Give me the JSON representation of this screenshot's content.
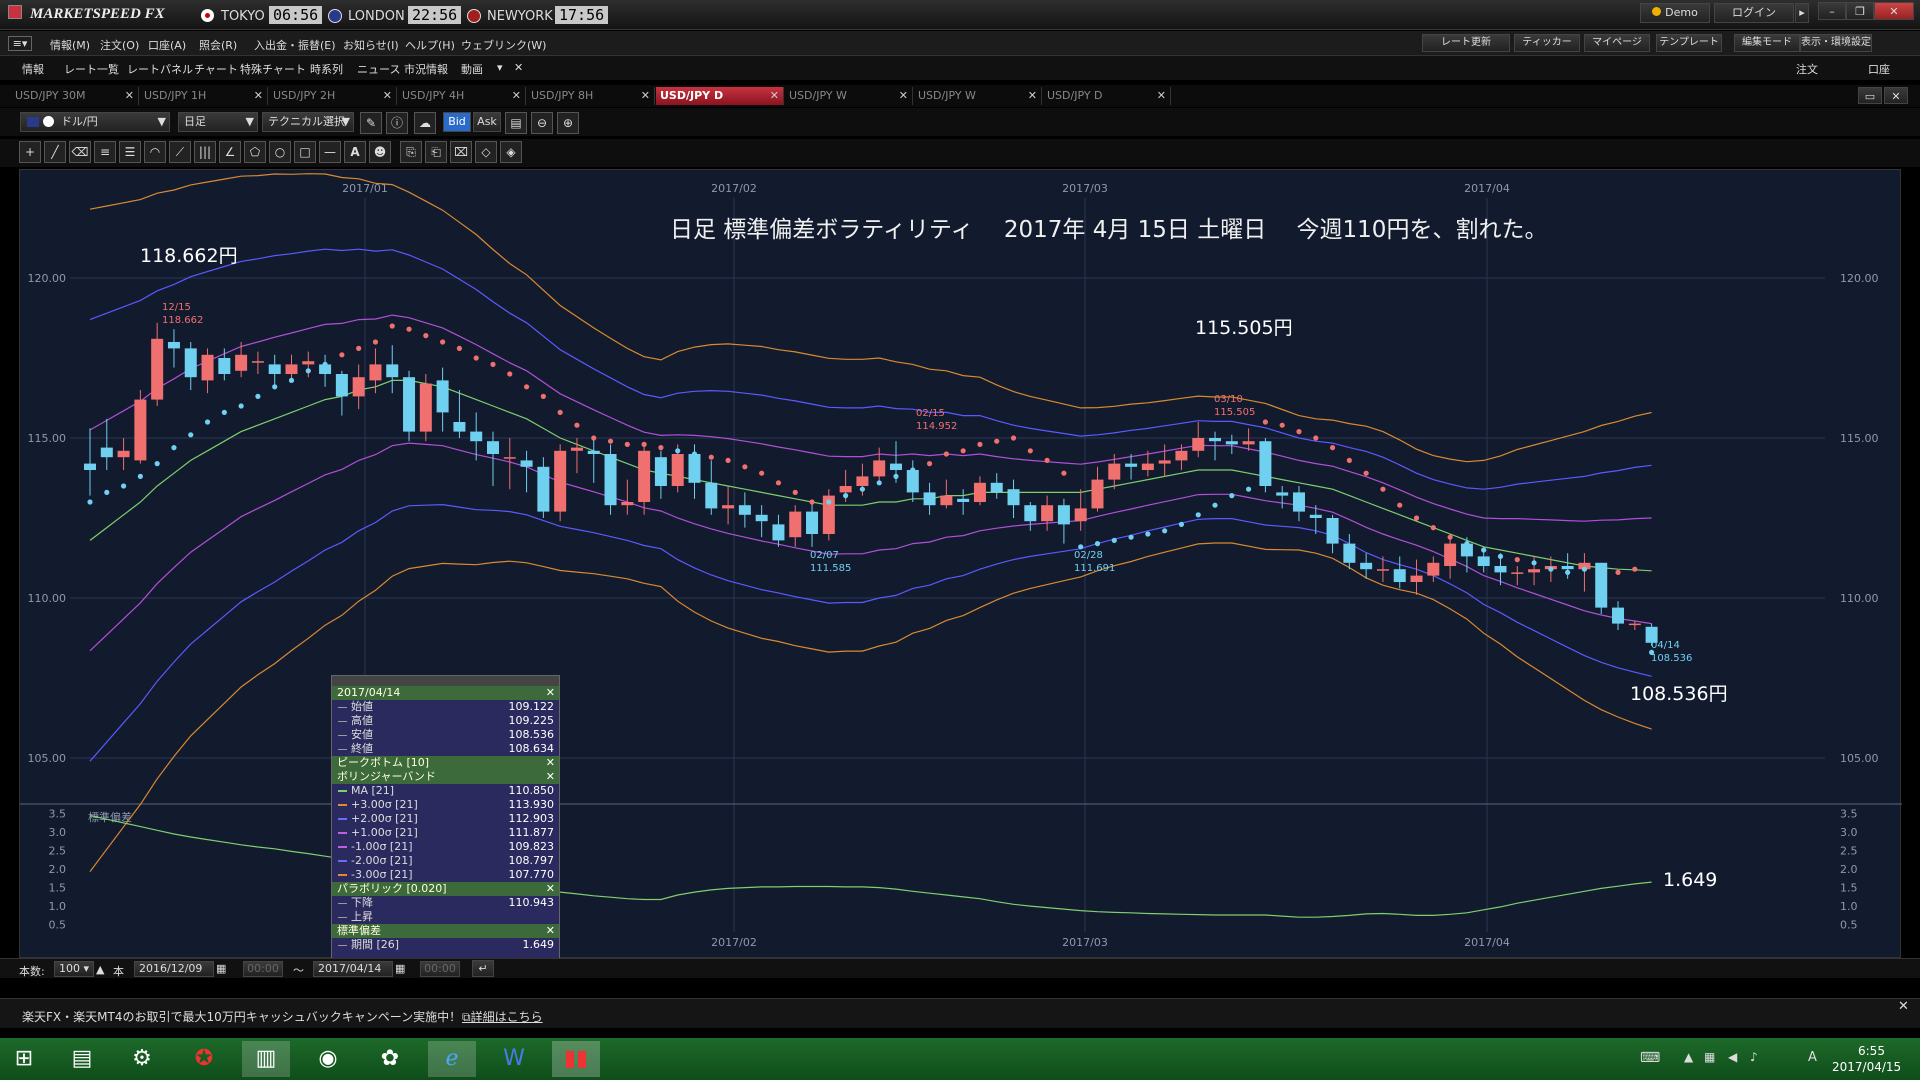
{
  "app": {
    "name": "MARKETSPEED FX",
    "demo": "Demo",
    "login": "ログイン"
  },
  "clocks": [
    {
      "city": "TOKYO",
      "time": "06:56"
    },
    {
      "city": "LONDON",
      "time": "22:56"
    },
    {
      "city": "NEWYORK",
      "time": "17:56"
    }
  ],
  "menu": [
    "情報(M)",
    "注文(O)",
    "口座(A)",
    "照会(R)",
    "入出金・振替(E)",
    "お知らせ(I)",
    "ヘルプ(H)",
    "ウェブリンク(W)"
  ],
  "menu_right": [
    "レート更新",
    "ティッカー",
    "マイページ",
    "テンプレート",
    "編集モード",
    "表示・環境設定"
  ],
  "submenu": [
    "情報",
    "レート一覧",
    "レートパネル",
    "チャート",
    "特殊チャート",
    "時系列",
    "ニュース",
    "市況情報",
    "動画"
  ],
  "submenu_right": [
    "注文",
    "口座"
  ],
  "tabs": [
    {
      "label": "USD/JPY 30M",
      "active": false
    },
    {
      "label": "USD/JPY 1H",
      "active": false
    },
    {
      "label": "USD/JPY 2H",
      "active": false
    },
    {
      "label": "USD/JPY 4H",
      "active": false
    },
    {
      "label": "USD/JPY 8H",
      "active": false
    },
    {
      "label": "USD/JPY D",
      "active": true
    },
    {
      "label": "USD/JPY W",
      "active": false
    },
    {
      "label": "USD/JPY W",
      "active": false
    },
    {
      "label": "USD/JPY D",
      "active": false
    }
  ],
  "toolbar": {
    "pair": "ドル/円",
    "period": "日足",
    "technical": "テクニカル選択",
    "bid": "Bid",
    "ask": "Ask"
  },
  "chart_data": {
    "type": "candlestick",
    "title": "日足 標準偏差ボラティリティ　 2017年 4月 15日 土曜日　 今週110円を、割れた。",
    "x_ticks": [
      "2017/01",
      "2017/02",
      "2017/03",
      "2017/04"
    ],
    "y_ticks": [
      "120.00",
      "115.00",
      "110.00",
      "105.00"
    ],
    "ylim": [
      104,
      121.5
    ],
    "sub_y_ticks": [
      "3.5",
      "3.0",
      "2.5",
      "2.0",
      "1.5",
      "1.0",
      "0.5"
    ],
    "sub_ylim": [
      0.3,
      3.6
    ],
    "sub_label": "標準偏差",
    "price_annotations": [
      {
        "text": "118.662円",
        "date": "12/15",
        "value": "118.662"
      },
      {
        "text": "115.505円",
        "date": "03/10",
        "value": "115.505"
      },
      {
        "text": "108.536円",
        "date": "04/14",
        "value": "108.536"
      }
    ],
    "low_annotations": [
      {
        "date": "02/15",
        "value": "114.952"
      },
      {
        "date": "02/07",
        "value": "111.585"
      },
      {
        "date": "02/28",
        "value": "111.691"
      }
    ],
    "sub_annotation": "1.649",
    "candles": [
      [
        114.2,
        114.0,
        115.3,
        113.2
      ],
      [
        114.7,
        114.4,
        115.6,
        114.0
      ],
      [
        114.4,
        114.6,
        115.0,
        114.0
      ],
      [
        114.3,
        116.2,
        116.5,
        114.2
      ],
      [
        116.2,
        118.1,
        118.6,
        116.0
      ],
      [
        118.0,
        117.8,
        118.4,
        117.2
      ],
      [
        117.8,
        116.9,
        118.0,
        116.5
      ],
      [
        116.8,
        117.6,
        117.8,
        116.4
      ],
      [
        117.5,
        117.0,
        117.8,
        116.8
      ],
      [
        117.1,
        117.6,
        118.0,
        116.9
      ],
      [
        117.4,
        117.4,
        117.7,
        117.0
      ],
      [
        117.3,
        117.0,
        117.6,
        116.6
      ],
      [
        117.0,
        117.3,
        117.6,
        116.8
      ],
      [
        117.3,
        117.4,
        117.7,
        116.9
      ],
      [
        117.3,
        117.0,
        117.6,
        116.6
      ],
      [
        117.0,
        116.3,
        117.1,
        115.7
      ],
      [
        116.3,
        116.9,
        117.3,
        115.9
      ],
      [
        116.8,
        117.3,
        117.8,
        116.4
      ],
      [
        117.3,
        116.9,
        117.9,
        116.4
      ],
      [
        116.9,
        115.2,
        117.1,
        114.9
      ],
      [
        115.2,
        116.7,
        117.0,
        114.9
      ],
      [
        116.8,
        115.8,
        117.2,
        115.2
      ],
      [
        115.5,
        115.2,
        116.5,
        115.0
      ],
      [
        115.2,
        114.9,
        115.8,
        114.3
      ],
      [
        114.9,
        114.5,
        115.2,
        113.5
      ],
      [
        114.4,
        114.4,
        115.0,
        113.4
      ],
      [
        114.3,
        114.1,
        114.6,
        113.3
      ],
      [
        114.1,
        112.7,
        114.4,
        112.5
      ],
      [
        112.7,
        114.6,
        114.8,
        112.4
      ],
      [
        114.6,
        114.7,
        115.0,
        113.9
      ],
      [
        114.6,
        114.5,
        115.0,
        113.6
      ],
      [
        114.5,
        112.9,
        114.8,
        112.6
      ],
      [
        112.9,
        113.0,
        113.7,
        112.6
      ],
      [
        113.0,
        114.6,
        114.8,
        112.6
      ],
      [
        114.4,
        113.5,
        114.6,
        113.1
      ],
      [
        113.5,
        114.5,
        114.8,
        113.3
      ],
      [
        114.5,
        113.6,
        114.8,
        113.1
      ],
      [
        113.6,
        112.8,
        114.3,
        112.6
      ],
      [
        112.8,
        112.9,
        113.5,
        112.3
      ],
      [
        112.9,
        112.6,
        113.3,
        112.2
      ],
      [
        112.6,
        112.4,
        112.9,
        111.9
      ],
      [
        112.3,
        111.8,
        112.6,
        111.6
      ],
      [
        111.9,
        112.7,
        112.9,
        111.6
      ],
      [
        112.7,
        112.0,
        113.0,
        111.6
      ],
      [
        112.0,
        113.2,
        113.4,
        111.8
      ],
      [
        113.3,
        113.5,
        114.0,
        113.0
      ],
      [
        113.5,
        113.8,
        114.2,
        113.2
      ],
      [
        113.8,
        114.3,
        114.7,
        113.6
      ],
      [
        114.2,
        114.0,
        114.9,
        113.6
      ],
      [
        114.0,
        113.3,
        114.3,
        113.0
      ],
      [
        113.3,
        112.9,
        113.6,
        112.6
      ],
      [
        112.9,
        113.2,
        113.7,
        112.8
      ],
      [
        113.1,
        113.0,
        113.4,
        112.6
      ],
      [
        113.0,
        113.6,
        113.8,
        112.9
      ],
      [
        113.6,
        113.3,
        113.9,
        113.1
      ],
      [
        113.4,
        112.9,
        113.7,
        112.5
      ],
      [
        112.9,
        112.4,
        113.0,
        112.1
      ],
      [
        112.4,
        112.9,
        113.2,
        112.1
      ],
      [
        112.9,
        112.3,
        113.1,
        111.7
      ],
      [
        112.4,
        112.8,
        113.4,
        112.1
      ],
      [
        112.8,
        113.7,
        114.1,
        112.7
      ],
      [
        113.7,
        114.2,
        114.5,
        113.4
      ],
      [
        114.2,
        114.1,
        114.5,
        113.7
      ],
      [
        114.0,
        114.2,
        114.6,
        113.8
      ],
      [
        114.2,
        114.3,
        114.8,
        113.8
      ],
      [
        114.3,
        114.6,
        114.8,
        114.0
      ],
      [
        114.6,
        115.0,
        115.5,
        114.4
      ],
      [
        115.0,
        114.9,
        115.2,
        114.3
      ],
      [
        114.9,
        114.8,
        115.1,
        114.5
      ],
      [
        114.8,
        114.9,
        115.3,
        114.6
      ],
      [
        114.9,
        113.5,
        115.0,
        113.3
      ],
      [
        113.3,
        113.2,
        113.5,
        112.8
      ],
      [
        113.3,
        112.7,
        113.5,
        112.4
      ],
      [
        112.6,
        112.5,
        112.9,
        112.0
      ],
      [
        112.5,
        111.7,
        112.6,
        111.4
      ],
      [
        111.7,
        111.1,
        112.0,
        110.9
      ],
      [
        111.1,
        110.9,
        111.4,
        110.6
      ],
      [
        110.9,
        110.9,
        111.3,
        110.5
      ],
      [
        110.9,
        110.5,
        111.3,
        110.3
      ],
      [
        110.5,
        110.7,
        111.2,
        110.1
      ],
      [
        110.7,
        111.1,
        111.3,
        110.5
      ],
      [
        111.0,
        111.7,
        111.9,
        110.6
      ],
      [
        111.7,
        111.3,
        111.9,
        110.8
      ],
      [
        111.3,
        111.0,
        111.6,
        110.8
      ],
      [
        111.0,
        110.8,
        111.4,
        110.4
      ],
      [
        110.8,
        110.8,
        111.0,
        110.4
      ],
      [
        110.8,
        110.9,
        111.3,
        110.4
      ],
      [
        110.9,
        111.0,
        111.3,
        110.5
      ],
      [
        111.0,
        110.9,
        111.4,
        110.6
      ],
      [
        110.9,
        111.1,
        111.4,
        110.2
      ],
      [
        111.1,
        109.7,
        111.1,
        109.5
      ],
      [
        109.7,
        109.2,
        109.9,
        109.0
      ],
      [
        109.2,
        109.2,
        109.3,
        109.0
      ],
      [
        109.1,
        108.6,
        109.2,
        108.5
      ]
    ],
    "ma": [
      111.8,
      112.2,
      112.6,
      113.0,
      113.5,
      113.9,
      114.3,
      114.6,
      114.9,
      115.2,
      115.4,
      115.6,
      115.8,
      116.0,
      116.2,
      116.3,
      116.5,
      116.6,
      116.8,
      116.8,
      116.7,
      116.6,
      116.4,
      116.2,
      116.0,
      115.8,
      115.6,
      115.3,
      115.0,
      114.8,
      114.6,
      114.4,
      114.2,
      114.0,
      113.9,
      113.8,
      113.7,
      113.6,
      113.5,
      113.4,
      113.3,
      113.2,
      113.1,
      113.0,
      112.9,
      112.9,
      112.9,
      113.0,
      113.0,
      113.1,
      113.1,
      113.2,
      113.2,
      113.3,
      113.3,
      113.3,
      113.3,
      113.3,
      113.3,
      113.3,
      113.4,
      113.5,
      113.6,
      113.7,
      113.8,
      113.9,
      114.0,
      114.0,
      114.0,
      113.9,
      113.8,
      113.7,
      113.6,
      113.5,
      113.4,
      113.2,
      113.0,
      112.8,
      112.6,
      112.4,
      112.2,
      112.0,
      111.8,
      111.6,
      111.5,
      111.4,
      111.3,
      111.2,
      111.1,
      111.0,
      110.95,
      110.9,
      110.88,
      110.85
    ],
    "sd": [
      3.45,
      3.35,
      3.25,
      3.15,
      3.05,
      2.95,
      2.87,
      2.8,
      2.73,
      2.66,
      2.6,
      2.55,
      2.48,
      2.42,
      2.35,
      2.28,
      2.2,
      2.12,
      2.04,
      1.96,
      1.9,
      1.84,
      1.78,
      1.72,
      1.63,
      1.55,
      1.5,
      1.44,
      1.38,
      1.33,
      1.28,
      1.24,
      1.2,
      1.18,
      1.18,
      1.3,
      1.38,
      1.44,
      1.48,
      1.5,
      1.52,
      1.52,
      1.53,
      1.53,
      1.53,
      1.52,
      1.52,
      1.5,
      1.46,
      1.4,
      1.35,
      1.3,
      1.25,
      1.2,
      1.12,
      1.05,
      1.0,
      0.96,
      0.92,
      0.88,
      0.85,
      0.83,
      0.82,
      0.8,
      0.79,
      0.78,
      0.77,
      0.76,
      0.76,
      0.76,
      0.76,
      0.73,
      0.7,
      0.7,
      0.72,
      0.75,
      0.79,
      0.8,
      0.78,
      0.75,
      0.75,
      0.78,
      0.82,
      0.9,
      0.98,
      1.08,
      1.16,
      1.24,
      1.32,
      1.4,
      1.48,
      1.54,
      1.6,
      1.649
    ],
    "sar": [
      113.0,
      113.3,
      113.5,
      113.8,
      114.2,
      114.7,
      115.1,
      115.5,
      115.8,
      116.0,
      116.3,
      116.6,
      116.8,
      117.1,
      117.3,
      117.6,
      117.8,
      118.0,
      118.5,
      118.4,
      118.2,
      118.0,
      117.8,
      117.5,
      117.3,
      117.0,
      116.6,
      116.3,
      115.8,
      115.4,
      115.0,
      114.9,
      114.8,
      114.8,
      114.7,
      114.6,
      114.5,
      114.4,
      114.3,
      114.1,
      113.9,
      113.6,
      113.3,
      113.0,
      113.0,
      113.2,
      113.4,
      113.6,
      113.8,
      114.0,
      114.2,
      114.5,
      114.6,
      114.8,
      114.9,
      115.0,
      114.6,
      114.3,
      113.9,
      111.6,
      111.7,
      111.8,
      111.9,
      112.0,
      112.1,
      112.3,
      112.6,
      112.9,
      113.2,
      113.4,
      115.5,
      115.4,
      115.2,
      115.0,
      114.7,
      114.3,
      113.9,
      113.4,
      112.9,
      112.5,
      112.2,
      111.9,
      111.7,
      111.5,
      111.3,
      111.2,
      111.1,
      110.9,
      110.8,
      110.9,
      111.0,
      110.8,
      110.9,
      108.3
    ]
  },
  "info_panel": {
    "date": "2017/04/14",
    "ohlc": [
      {
        "label": "始値",
        "value": "109.122"
      },
      {
        "label": "高値",
        "value": "109.225"
      },
      {
        "label": "安値",
        "value": "108.536"
      },
      {
        "label": "終値",
        "value": "108.634"
      }
    ],
    "peak_bottom": "ピークボトム [10]",
    "bb_title": "ボリンジャーバンド",
    "bb_rows": [
      {
        "label": "MA [21]",
        "value": "110.850",
        "color": "#7ecf6e"
      },
      {
        "label": "+3.00σ [21]",
        "value": "113.930",
        "color": "#e08a30"
      },
      {
        "label": "+2.00σ [21]",
        "value": "112.903",
        "color": "#6a6aff"
      },
      {
        "label": "+1.00σ [21]",
        "value": "111.877",
        "color": "#c060e0"
      },
      {
        "label": "-1.00σ [21]",
        "value": "109.823",
        "color": "#c060e0"
      },
      {
        "label": "-2.00σ [21]",
        "value": "108.797",
        "color": "#6a6aff"
      },
      {
        "label": "-3.00σ [21]",
        "value": "107.770",
        "color": "#e08a30"
      }
    ],
    "sar_title": "パラボリック [0.020]",
    "sar_rows": [
      {
        "label": "下降",
        "value": "110.943"
      },
      {
        "label": "上昇",
        "value": ""
      }
    ],
    "sd_title": "標準偏差",
    "sd_rows": [
      {
        "label": "期間 [26]",
        "value": "1.649"
      }
    ]
  },
  "bottom": {
    "count_label": "本数:",
    "count": "100",
    "unit": "本",
    "from_date": "2016/12/09",
    "from_time": "00:00",
    "sep": "～",
    "to_date": "2017/04/14",
    "to_time": "00:00"
  },
  "banner": {
    "text": "楽天FX・楽天MT4のお取引で最大10万円キャッシュバックキャンペーン実施中！",
    "link": "詳細はこちら"
  },
  "taskbar": {
    "time": "6:55",
    "date": "2017/04/15",
    "ime": "A"
  },
  "colors": {
    "up": "#f07070",
    "down": "#6fd0f0",
    "bg": "#121a2d",
    "accent": "#c83240"
  }
}
